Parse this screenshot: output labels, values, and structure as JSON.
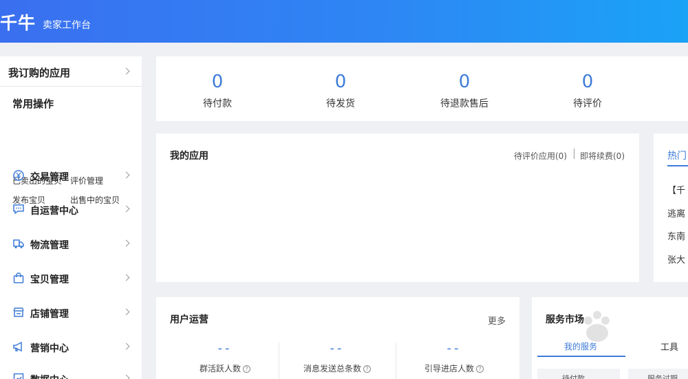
{
  "header": {
    "logo": "千牛",
    "subtitle": "卖家工作台"
  },
  "sidebar": {
    "title": "我订购的应用",
    "common_title": "常用操作",
    "common_ops": [
      "已卖出的宝贝",
      "评价管理",
      "发布宝贝",
      "出售中的宝贝"
    ],
    "menu": [
      {
        "label": "交易管理",
        "icon": "yen-exchange-icon"
      },
      {
        "label": "自运营中心",
        "icon": "chat-bubble-icon"
      },
      {
        "label": "物流管理",
        "icon": "truck-icon"
      },
      {
        "label": "宝贝管理",
        "icon": "shopping-bag-icon"
      },
      {
        "label": "店铺管理",
        "icon": "store-icon"
      },
      {
        "label": "营销中心",
        "icon": "megaphone-icon"
      },
      {
        "label": "数据中心",
        "icon": "chart-icon"
      }
    ]
  },
  "stats": [
    {
      "value": "0",
      "label": "待付款"
    },
    {
      "value": "0",
      "label": "待发货"
    },
    {
      "value": "0",
      "label": "待退款售后"
    },
    {
      "value": "0",
      "label": "待评价"
    }
  ],
  "my_apps": {
    "title": "我的应用",
    "link_pending": "待评价应用(0)",
    "link_renew": "即将续费(0)"
  },
  "hot": {
    "tab": "热门",
    "items": [
      "【千",
      "逃离",
      "东南",
      "张大"
    ]
  },
  "user_ops": {
    "title": "用户运营",
    "more": "更多",
    "metrics": [
      {
        "value": "--",
        "label": "群活跃人数"
      },
      {
        "value": "--",
        "label": "消息发送总条数"
      },
      {
        "value": "--",
        "label": "引导进店人数"
      }
    ]
  },
  "service_market": {
    "title": "服务市场",
    "tab_my": "我的服务",
    "tab_tools": "工具",
    "row_left": "待付款",
    "row_right": "服务过期"
  },
  "colors": {
    "accent": "#3d7cd9",
    "header_start": "#3a6ff0",
    "header_end": "#1aa3f7"
  }
}
